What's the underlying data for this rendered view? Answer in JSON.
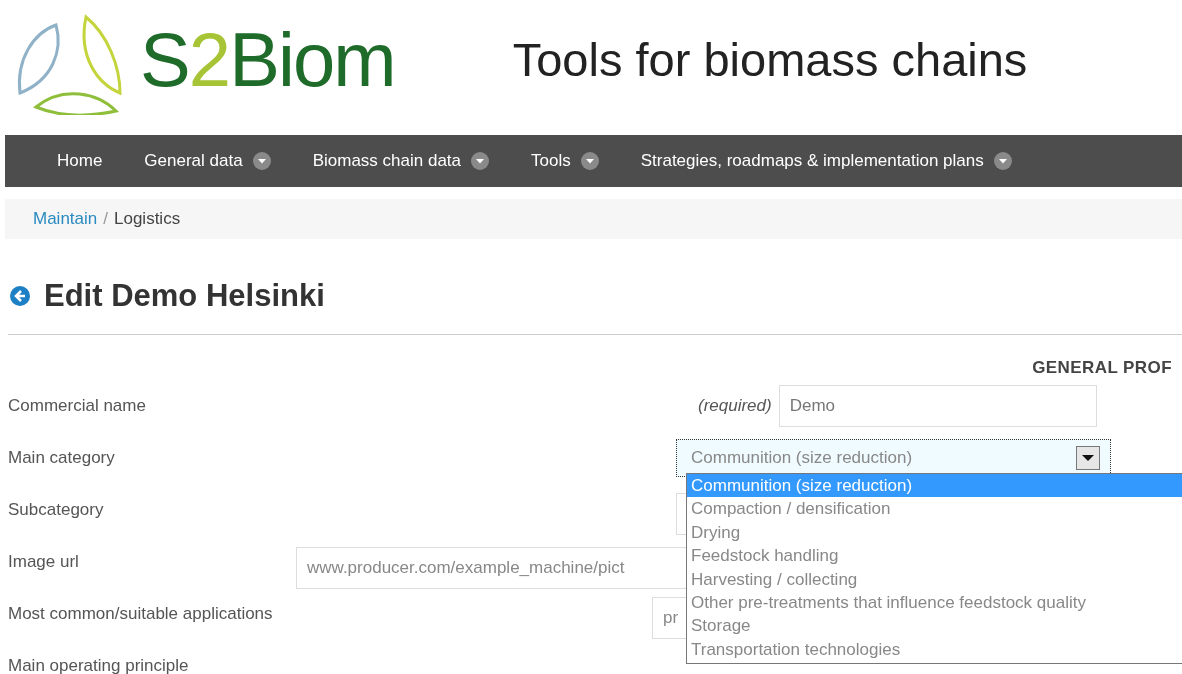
{
  "header": {
    "logo": {
      "prefix": "S",
      "digit": "2",
      "suffix": "Biom"
    },
    "tagline": "Tools for biomass chains"
  },
  "nav": [
    {
      "label": "Home",
      "has_menu": false
    },
    {
      "label": "General data",
      "has_menu": true
    },
    {
      "label": "Biomass chain data",
      "has_menu": true
    },
    {
      "label": "Tools",
      "has_menu": true
    },
    {
      "label": "Strategies, roadmaps & implementation plans",
      "has_menu": true
    }
  ],
  "breadcrumb": [
    {
      "label": "Maintain",
      "link": true
    },
    {
      "label": "Logistics",
      "link": false
    }
  ],
  "breadcrumb_separator": "/",
  "page_title": "Edit Demo Helsinki",
  "section_heading": "GENERAL PROF",
  "fields": [
    {
      "label": "Commercial name",
      "kind": "text",
      "note": "(required)",
      "value": "Demo"
    },
    {
      "label": "Main category",
      "kind": "select",
      "value": "Communition (size reduction)",
      "expanded": true,
      "options": [
        {
          "label": "Communition (size reduction)",
          "selected": true
        },
        {
          "label": "Compaction / densification",
          "selected": false
        },
        {
          "label": "Drying",
          "selected": false
        },
        {
          "label": "Feedstock handling",
          "selected": false
        },
        {
          "label": "Harvesting / collecting",
          "selected": false
        },
        {
          "label": "Other pre-treatments that influence feedstock quality",
          "selected": false
        },
        {
          "label": "Storage",
          "selected": false
        },
        {
          "label": "Transportation technologies",
          "selected": false
        }
      ]
    },
    {
      "label": "Subcategory",
      "kind": "covered"
    },
    {
      "label": "Image url",
      "kind": "wide",
      "value": "www.producer.com/example_machine/pict"
    },
    {
      "label": "Most common/suitable applications",
      "kind": "short",
      "value": "pr"
    },
    {
      "label": "Main operating principle",
      "kind": "none"
    }
  ]
}
